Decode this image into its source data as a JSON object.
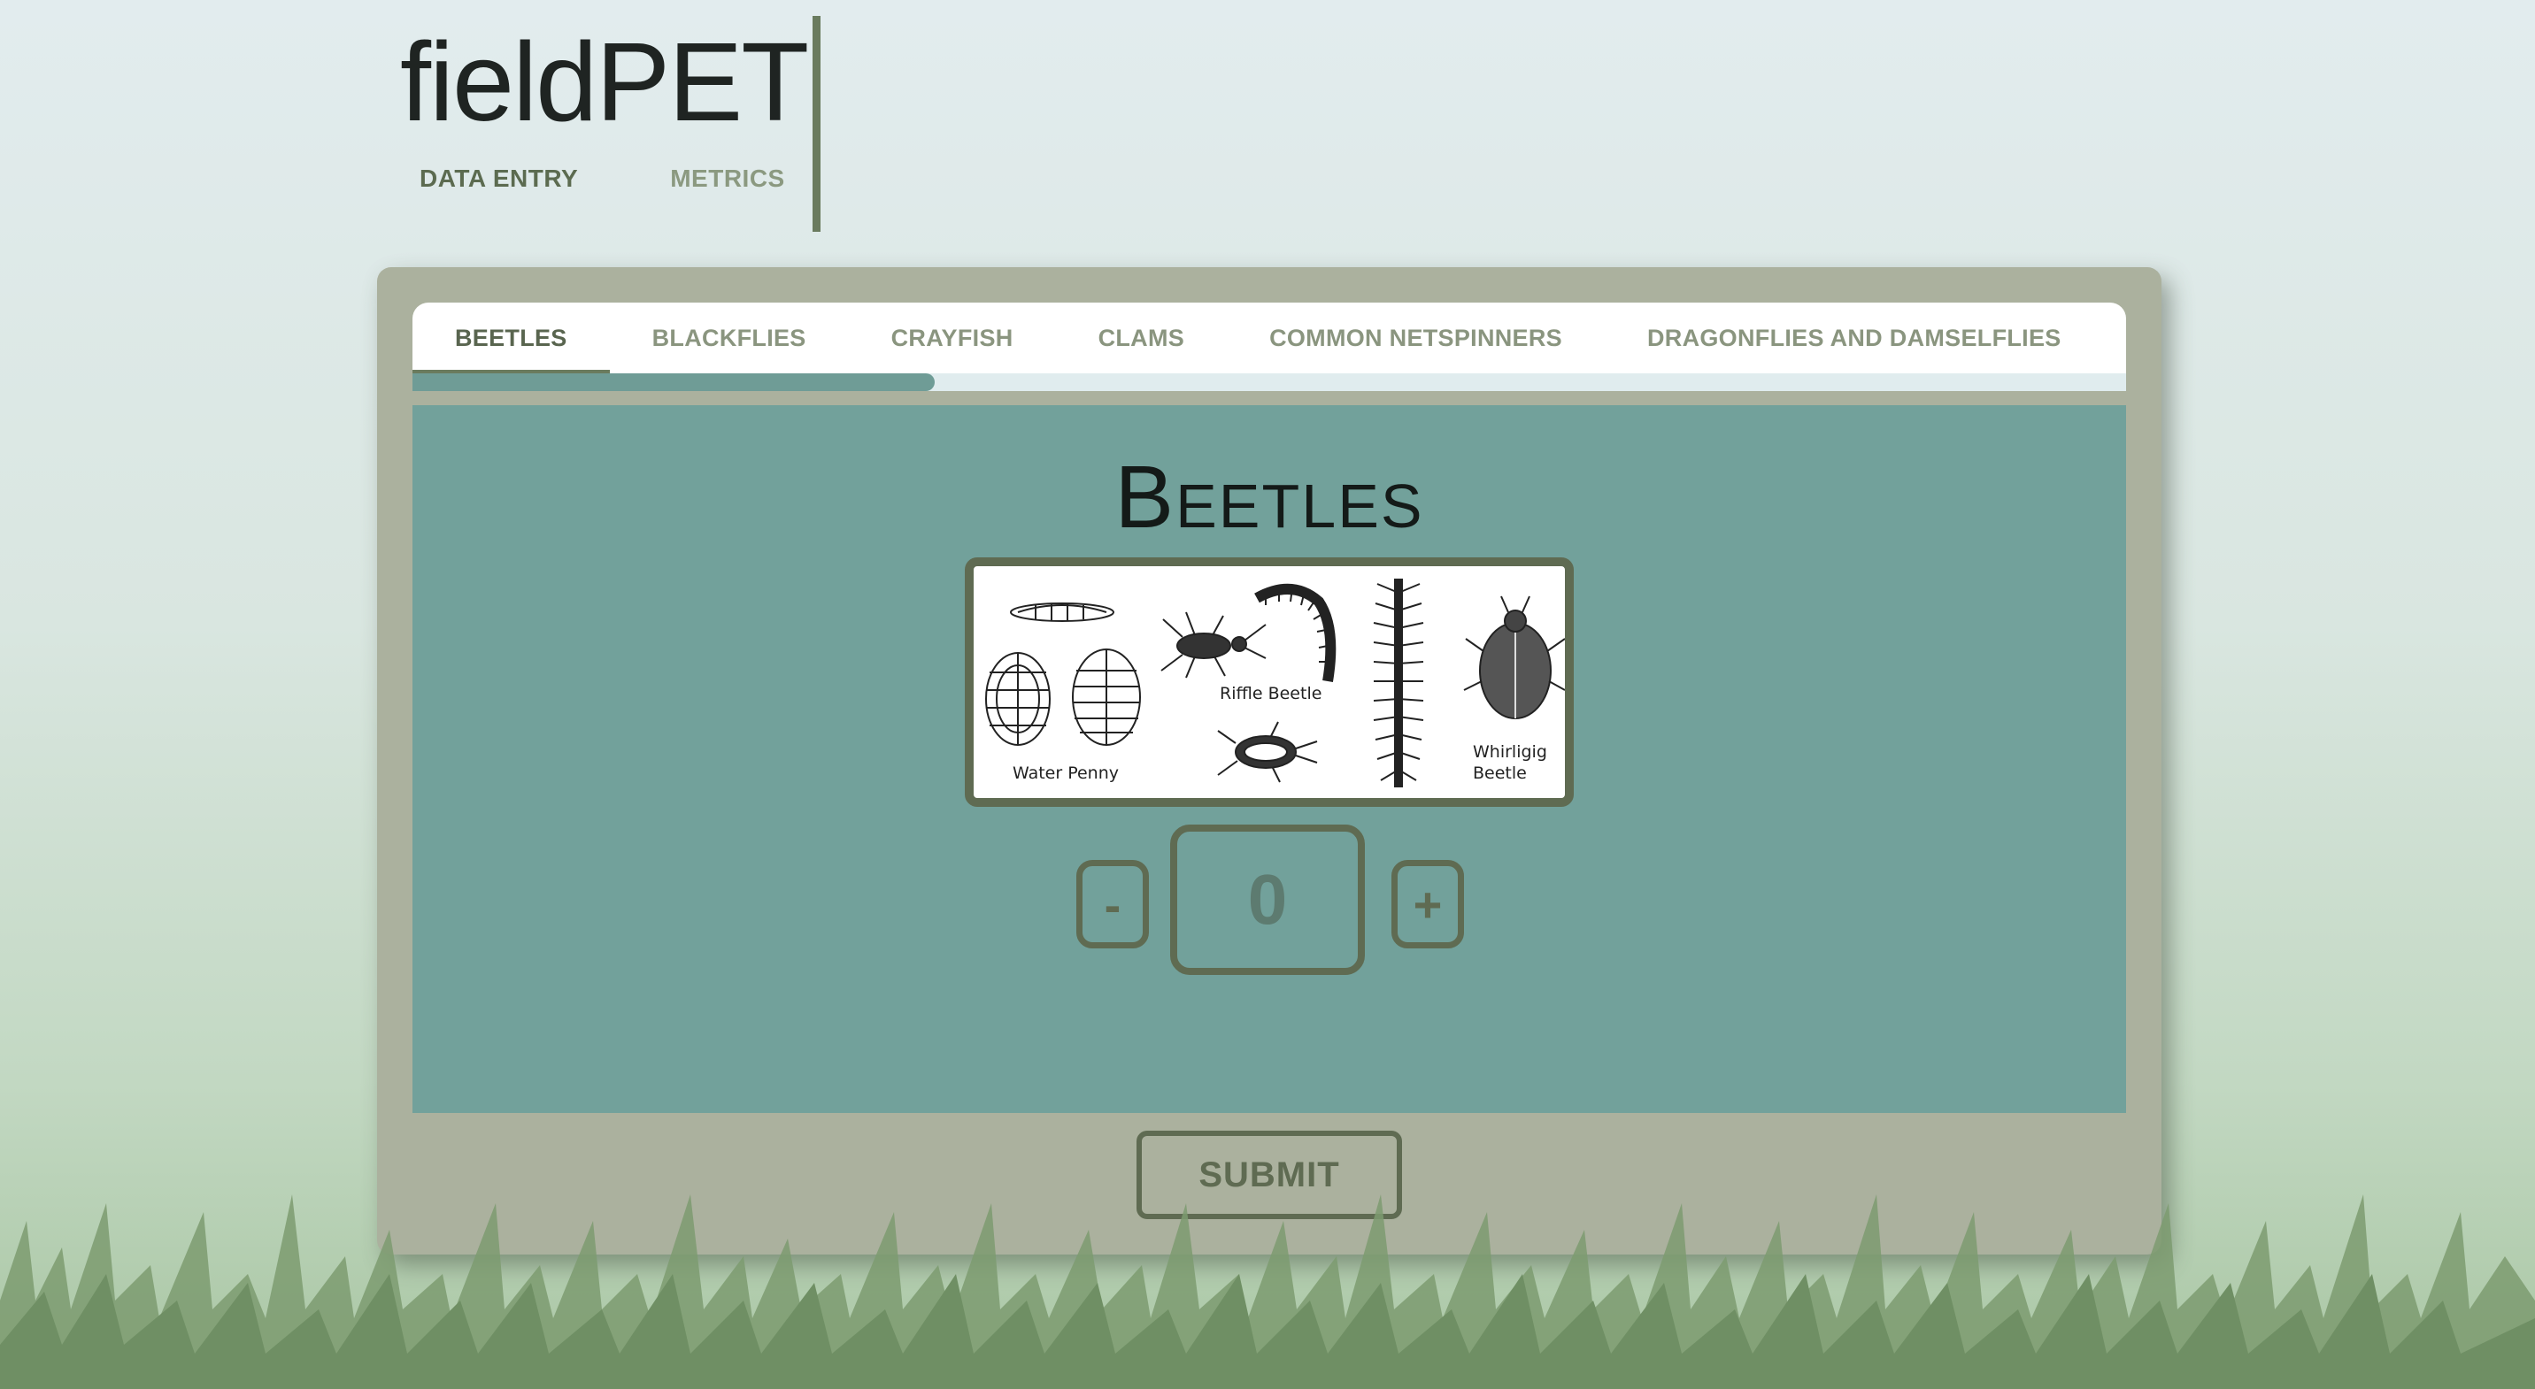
{
  "app": {
    "title": "fieldPET"
  },
  "nav": {
    "items": [
      {
        "label": "DATA ENTRY",
        "active": true
      },
      {
        "label": "METRICS",
        "active": false
      }
    ]
  },
  "tabs": [
    {
      "label": "BEETLES",
      "active": true
    },
    {
      "label": "BLACKFLIES",
      "active": false
    },
    {
      "label": "CRAYFISH",
      "active": false
    },
    {
      "label": "CLAMS",
      "active": false
    },
    {
      "label": "COMMON NETSPINNERS",
      "active": false
    },
    {
      "label": "DRAGONFLIES AND DAMSELFLIES",
      "active": false
    }
  ],
  "tab_scroll_progress": 0.305,
  "panel": {
    "title": "Beetles",
    "illustration": {
      "labels": {
        "water_penny": "Water Penny",
        "riffle_beetle": "Riffle Beetle",
        "whirligig_line1": "Whirligig",
        "whirligig_line2": "Beetle"
      }
    },
    "counter": {
      "minus_label": "-",
      "value": "0",
      "plus_label": "+"
    }
  },
  "submit_label": "SUBMIT",
  "colors": {
    "card": "#abb19e",
    "panel": "#72a19b",
    "accent": "#5f6b52",
    "progress": "#6f9c96",
    "grass": "#7a9c6e"
  },
  "icons": {
    "illustration": "beetle-illustration",
    "decoration": "grass-decoration"
  }
}
